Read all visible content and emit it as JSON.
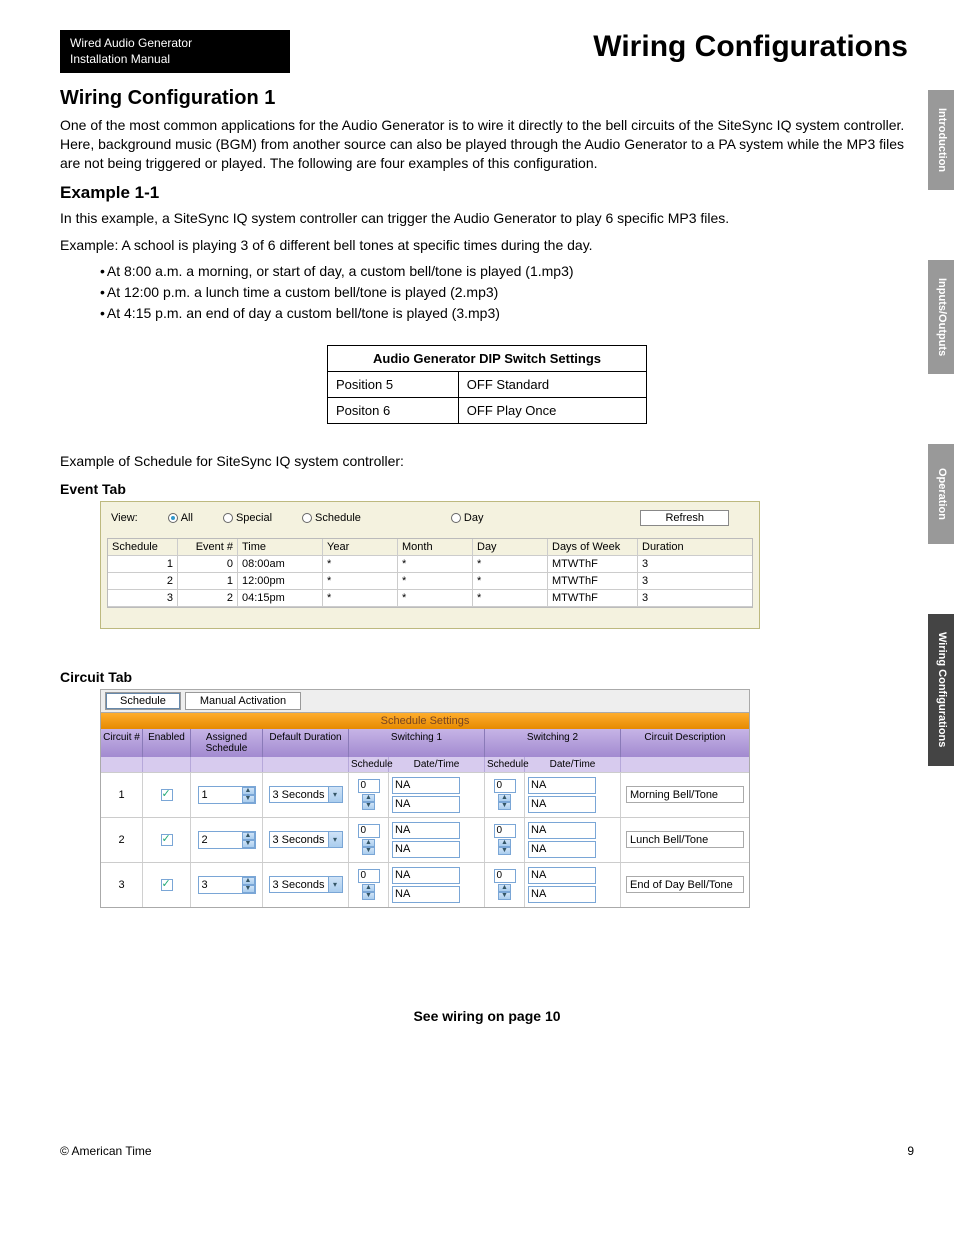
{
  "doc_tag_line1": "Wired Audio Generator",
  "doc_tag_line2": "Installation Manual",
  "page_title": "Wiring Configurations",
  "side_tabs": [
    "Introduction",
    "Inputs/Outputs",
    "Operation",
    "Wiring Configurations"
  ],
  "h_wc1": "Wiring Configuration 1",
  "p_wc1": "One of the most common applications for the Audio Generator is to wire it directly to the bell circuits of the SiteSync IQ system controller. Here, background music (BGM) from another source can also be played through the Audio Generator to a PA system while the MP3 files are not being triggered or played. The following are four examples of this configuration.",
  "h_ex11": "Example 1-1",
  "p_ex11a": "In this example, a SiteSync IQ system controller can trigger the Audio Generator to play 6 specific MP3 files.",
  "p_ex11b": "Example: A school is playing 3 of 6 different bell tones at specific times during the day.",
  "bullets": [
    "At 8:00 a.m. a morning, or start of day, a custom bell/tone is played (1.mp3)",
    "At 12:00 p.m. a lunch time a custom bell/tone is played (2.mp3)",
    "At 4:15 p.m. an end of day a custom bell/tone is played (3.mp3)"
  ],
  "dip": {
    "title": "Audio Generator DIP Switch Settings",
    "rows": [
      {
        "col1": "Position 5",
        "col2": "OFF Standard"
      },
      {
        "col1": "Positon 6",
        "col2": "OFF Play Once"
      }
    ]
  },
  "schedule_caption": "Example of Schedule for SiteSync IQ system controller:",
  "event_tab_label": "Event Tab",
  "event": {
    "view_label": "View:",
    "radios": [
      "All",
      "Special",
      "Schedule",
      "Day"
    ],
    "refresh": "Refresh",
    "headers": [
      "Schedule",
      "Event #",
      "Time",
      "Year",
      "Month",
      "Day",
      "Days of Week",
      "Duration"
    ],
    "rows": [
      {
        "sched": "1",
        "ev": "0",
        "time": "08:00am",
        "year": "*",
        "month": "*",
        "day": "*",
        "dow": "MTWThF",
        "dur": "3"
      },
      {
        "sched": "2",
        "ev": "1",
        "time": "12:00pm",
        "year": "*",
        "month": "*",
        "day": "*",
        "dow": "MTWThF",
        "dur": "3"
      },
      {
        "sched": "3",
        "ev": "2",
        "time": "04:15pm",
        "year": "*",
        "month": "*",
        "day": "*",
        "dow": "MTWThF",
        "dur": "3"
      }
    ]
  },
  "circuit_tab_label": "Circuit Tab",
  "circuit": {
    "tabs": [
      "Schedule",
      "Manual Activation"
    ],
    "title_bar": "Schedule Settings",
    "head": {
      "circuit": "Circuit #",
      "enabled": "Enabled",
      "assigned": "Assigned Schedule",
      "default": "Default Duration",
      "sw1": "Switching 1",
      "sw2": "Switching 2",
      "desc": "Circuit Description",
      "sub_schedule": "Schedule",
      "sub_datetime": "Date/Time"
    },
    "rows": [
      {
        "n": "1",
        "assigned": "1",
        "duration": "3 Seconds",
        "swn": "0",
        "na": "NA",
        "desc": "Morning Bell/Tone"
      },
      {
        "n": "2",
        "assigned": "2",
        "duration": "3 Seconds",
        "swn": "0",
        "na": "NA",
        "desc": "Lunch Bell/Tone"
      },
      {
        "n": "3",
        "assigned": "3",
        "duration": "3 Seconds",
        "swn": "0",
        "na": "NA",
        "desc": "End of Day Bell/Tone"
      }
    ]
  },
  "see_wiring": "See wiring on page 10",
  "copyright": "© American Time",
  "page_num": "9"
}
